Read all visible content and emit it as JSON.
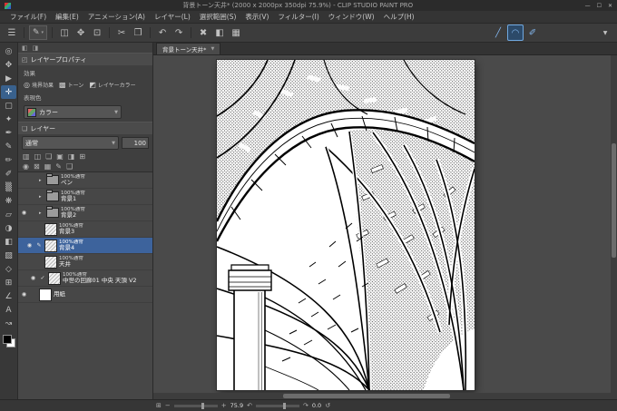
{
  "window": {
    "title": "背景トーン天井* (2000 x 2000px 350dpi 75.9%) - CLIP STUDIO PAINT PRO",
    "minimize": "—",
    "maximize": "☐",
    "close": "✕"
  },
  "menu": {
    "items": [
      "ファイル(F)",
      "編集(E)",
      "アニメーション(A)",
      "レイヤー(L)",
      "選択範囲(S)",
      "表示(V)",
      "フィルター(I)",
      "ウィンドウ(W)",
      "ヘルプ(H)"
    ]
  },
  "toolbar": {
    "menu_glyph": "☰",
    "subtool_glyph": "✎",
    "subtool_caret": "▾",
    "icons": [
      {
        "name": "page-manager-icon",
        "glyph": "◫"
      },
      {
        "name": "transform-icon",
        "glyph": "✥"
      },
      {
        "name": "snap-icon",
        "glyph": "⊡"
      },
      {
        "name": "cut-icon",
        "glyph": "✂"
      },
      {
        "name": "copy-icon",
        "glyph": "❐"
      },
      {
        "name": "undo-icon",
        "glyph": "↶"
      },
      {
        "name": "redo-icon",
        "glyph": "↷"
      },
      {
        "name": "clear-icon",
        "glyph": "✖"
      },
      {
        "name": "fill-icon",
        "glyph": "◧"
      },
      {
        "name": "grid-icon",
        "glyph": "▦"
      }
    ],
    "line_tools": [
      {
        "name": "straight-line-icon",
        "glyph": "╱"
      },
      {
        "name": "curve-line-icon",
        "glyph": "◠"
      },
      {
        "name": "polyline-icon",
        "glyph": "✐"
      }
    ],
    "end_caret": "▼",
    "accent_color": "#82b6ee"
  },
  "tools": {
    "items": [
      {
        "name": "zoom-tool",
        "glyph": "◎"
      },
      {
        "name": "move-tool",
        "glyph": "✥"
      },
      {
        "name": "operation-tool",
        "glyph": "▶"
      },
      {
        "name": "layer-move-tool",
        "glyph": "✛",
        "active": true
      },
      {
        "name": "selection-tool",
        "glyph": "▢"
      },
      {
        "name": "auto-select-tool",
        "glyph": "✦"
      },
      {
        "name": "eyedropper-tool",
        "glyph": "✒"
      },
      {
        "name": "pen-tool",
        "glyph": "✎"
      },
      {
        "name": "pencil-tool",
        "glyph": "✏"
      },
      {
        "name": "brush-tool",
        "glyph": "✐"
      },
      {
        "name": "airbrush-tool",
        "glyph": "▒"
      },
      {
        "name": "decoration-tool",
        "glyph": "❋"
      },
      {
        "name": "eraser-tool",
        "glyph": "▱"
      },
      {
        "name": "blend-tool",
        "glyph": "◑"
      },
      {
        "name": "fill-tool",
        "glyph": "◧"
      },
      {
        "name": "gradient-tool",
        "glyph": "▨"
      },
      {
        "name": "figure-tool",
        "glyph": "◇"
      },
      {
        "name": "frame-border-tool",
        "glyph": "⊞"
      },
      {
        "name": "ruler-tool",
        "glyph": "∠"
      },
      {
        "name": "text-tool",
        "glyph": "A"
      },
      {
        "name": "line-correct-tool",
        "glyph": "↝"
      }
    ],
    "fg_color": "#000000",
    "bg_color": "#ffffff",
    "active_highlight": "#39618d"
  },
  "dock": {
    "icon1": "◧",
    "icon2": "◨"
  },
  "layer_property": {
    "title": "レイヤープロパティ",
    "header_icon": "◰",
    "section_effect": "効果",
    "effects": [
      {
        "label": "境界効果",
        "glyph": "◎"
      },
      {
        "label": "トーン",
        "glyph": "▩"
      },
      {
        "label": "レイヤーカラー",
        "glyph": "◩"
      }
    ],
    "expression_label": "表現色",
    "expression_value": "カラー"
  },
  "layers_panel": {
    "title": "レイヤー",
    "header_icon": "❏",
    "blend_mode": "通常",
    "opacity": "100",
    "toolbar1": [
      "▥",
      "◫",
      "❏",
      "▣",
      "◨",
      "⊞"
    ],
    "toolbar2": [
      "◉",
      "⊠",
      "▦",
      "✎",
      "❑"
    ],
    "rows": [
      {
        "info": "100%通常",
        "name": "ペン",
        "arrow": "▸",
        "type": "folder"
      },
      {
        "info": "100%通常",
        "name": "背景1",
        "arrow": "▸",
        "type": "folder"
      },
      {
        "info": "100%通常",
        "name": "背景2",
        "arrow": "▸",
        "eye": "◉",
        "type": "folder"
      },
      {
        "info": "100%通常",
        "name": "背景3",
        "type": "layer"
      },
      {
        "info": "100%通常",
        "name": "背景4",
        "eye": "◉",
        "mark": "✎",
        "selected": true,
        "type": "layer"
      },
      {
        "info": "100%通常",
        "name": "天井",
        "type": "layer"
      },
      {
        "info": "100%通常",
        "name": "中世の回廊01 中央 天頂 V2",
        "eye": "◉",
        "mark": "✓",
        "type": "layer"
      },
      {
        "name": "用紙",
        "eye": "◉",
        "type": "paper"
      }
    ],
    "selected_color": "#3d639c"
  },
  "canvas": {
    "tab_label": "背景トーン天井*",
    "tab_caret": "▼",
    "surround_color": "#4a4a4a"
  },
  "status": {
    "nav_glyph": "⊞",
    "zoom_out": "−",
    "zoom_in": "+",
    "zoom_value": "75.9",
    "rotate_left": "↶",
    "rotate_right": "↷",
    "rotation_value": "0.0",
    "reset_glyph": "↺"
  }
}
